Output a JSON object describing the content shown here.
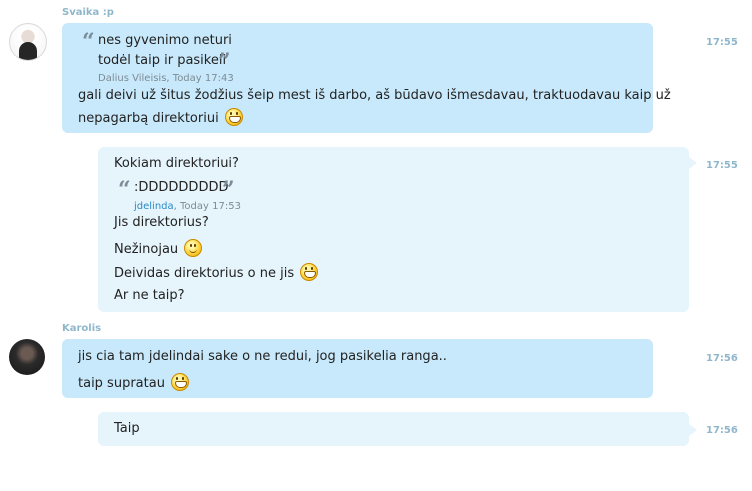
{
  "messages": [
    {
      "sender": "Svaika :p",
      "time": "17:55",
      "quote": {
        "open_mark": "“",
        "close_mark": "”",
        "lines": [
          "nes gyvenimo neturi",
          "todėl taip ir pasikeli"
        ],
        "author": "Dalius Vileisis",
        "timestamp": "Today 17:43"
      },
      "text_lines": [
        "gali deivi už šitus žodžius šeip mest iš darbo, aš būdavo išmesdavau, traktuodavau kaip už",
        "nepagarbą direktoriui"
      ],
      "emoticon": "grin-icon"
    },
    {
      "time": "17:55",
      "lines": [
        "Kokiam direktoriui?",
        "Jis direktorius?",
        "Nežinojau",
        "Deividas direktorius o ne jis",
        "Ar ne taip?"
      ],
      "quote": {
        "open_mark": "“",
        "close_mark": "”",
        "text": ":DDDDDDDDD",
        "author": "jdelinda",
        "timestamp": "Today 17:53"
      }
    },
    {
      "sender": "Karolis",
      "time": "17:56",
      "lines": [
        "jis cia tam jdelindai sake o ne redui, jog pasikelia ranga..",
        "taip supratau"
      ]
    },
    {
      "time": "17:56",
      "lines": [
        "Taip"
      ]
    }
  ],
  "colors": {
    "incoming_bubble": "#c8e9fb",
    "outgoing_bubble": "#e6f4fc",
    "meta_text": "#8fb7cc",
    "link": "#2a8bc7"
  }
}
